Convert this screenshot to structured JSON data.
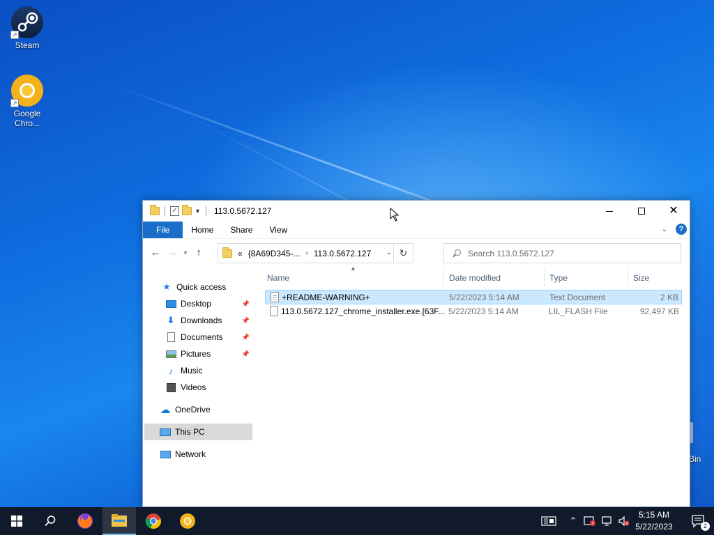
{
  "desktop": {
    "icons": [
      {
        "label": "Steam"
      },
      {
        "label": "Google Chro..."
      }
    ],
    "recycle_bin_partial_label": "Bin"
  },
  "window": {
    "title": "113.0.5672.127",
    "ribbon_tabs": [
      "File",
      "Home",
      "Share",
      "View"
    ],
    "address": {
      "prefix": "«",
      "segments": [
        "{8A69D345-...",
        "113.0.5672.127"
      ]
    },
    "search_placeholder": "Search 113.0.5672.127",
    "nav_pane": [
      {
        "label": "Quick access",
        "icon": "star-icon"
      },
      {
        "label": "Desktop",
        "icon": "desktop-icon",
        "pinned": true
      },
      {
        "label": "Downloads",
        "icon": "downloads-icon",
        "pinned": true
      },
      {
        "label": "Documents",
        "icon": "documents-icon",
        "pinned": true
      },
      {
        "label": "Pictures",
        "icon": "pictures-icon",
        "pinned": true
      },
      {
        "label": "Music",
        "icon": "music-icon"
      },
      {
        "label": "Videos",
        "icon": "videos-icon"
      },
      {
        "label": "OneDrive",
        "icon": "cloud-icon"
      },
      {
        "label": "This PC",
        "icon": "computer-icon",
        "selected": true
      },
      {
        "label": "Network",
        "icon": "network-icon"
      }
    ],
    "columns": [
      "Name",
      "Date modified",
      "Type",
      "Size"
    ],
    "files": [
      {
        "name": "+README-WARNING+",
        "date": "5/22/2023 5:14 AM",
        "type": "Text Document",
        "size": "2 KB",
        "selected": true
      },
      {
        "name": "113.0.5672.127_chrome_installer.exe.[63F...",
        "date": "5/22/2023 5:14 AM",
        "type": "LIL_FLASH File",
        "size": "92,497 KB"
      }
    ]
  },
  "taskbar": {
    "clock_time": "5:15 AM",
    "clock_date": "5/22/2023",
    "notification_count": "2",
    "apps": [
      "start-icon",
      "search-icon",
      "firefox-icon",
      "file-explorer-icon",
      "chrome-icon",
      "chrome-canary-icon"
    ]
  },
  "colors": {
    "accent": "#1a6ec9",
    "selection": "#cce8ff",
    "taskbar": "#101a2a"
  }
}
